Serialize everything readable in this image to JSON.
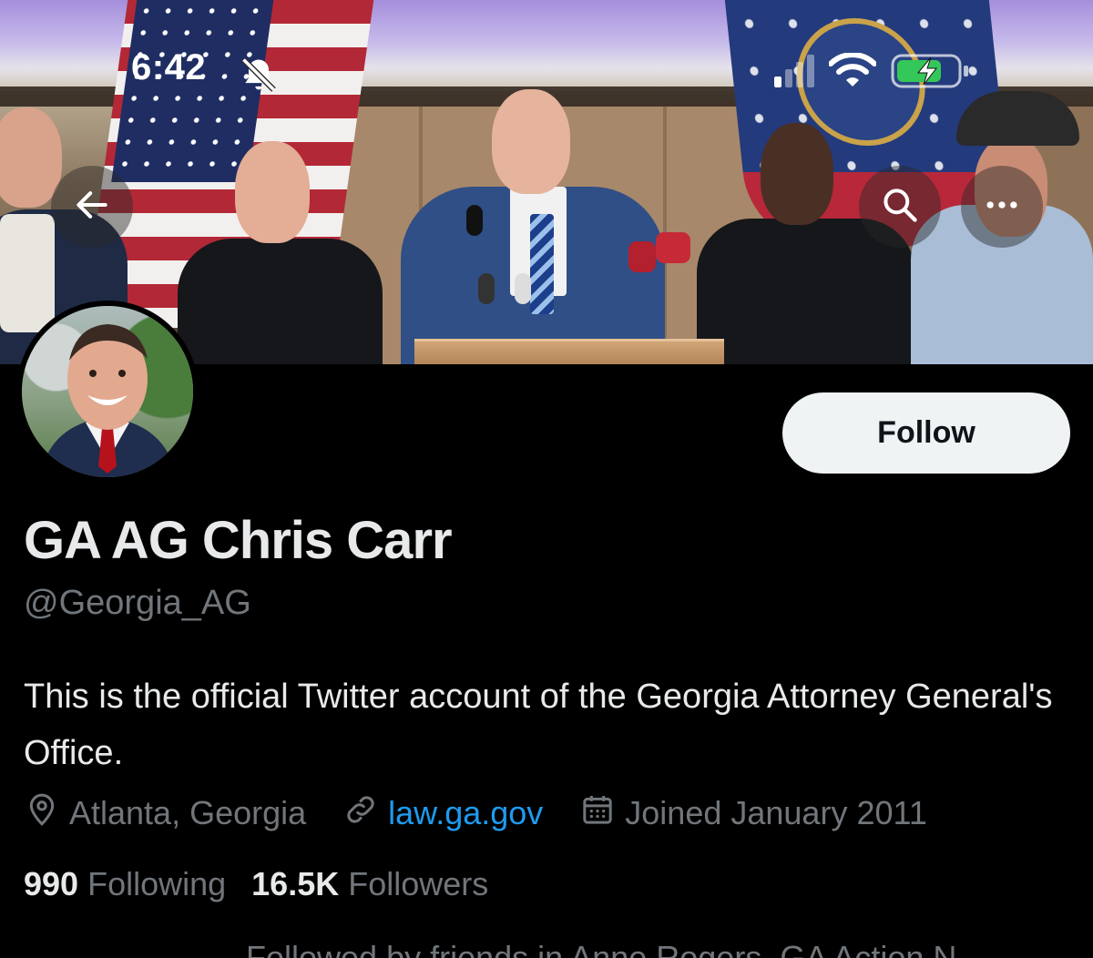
{
  "status_bar": {
    "time": "6:42",
    "icons": [
      "bell-slash-icon",
      "signal-icon",
      "wifi-icon",
      "battery-charging-icon"
    ]
  },
  "header": {
    "back_icon": "arrow-left-icon",
    "search_icon": "search-icon",
    "more_icon": "more-horizontal-icon"
  },
  "profile": {
    "follow_label": "Follow",
    "display_name": "GA AG Chris Carr",
    "handle": "@Georgia_AG",
    "bio": "This is the official Twitter account of the Georgia Attorney General's Office.",
    "location": "Atlanta, Georgia",
    "website": "law.ga.gov",
    "joined": "Joined January 2011",
    "following_count": "990",
    "following_label": "Following",
    "followers_count": "16.5K",
    "followers_label": "Followers",
    "followed_by_text": "Followed by friends in Anne Rogers, GA Action N"
  },
  "colors": {
    "background": "#000000",
    "text_primary": "#e7e9ea",
    "text_secondary": "#71767b",
    "link": "#1d9bf0",
    "follow_bg": "#eff3f4",
    "battery_green": "#34c759"
  }
}
